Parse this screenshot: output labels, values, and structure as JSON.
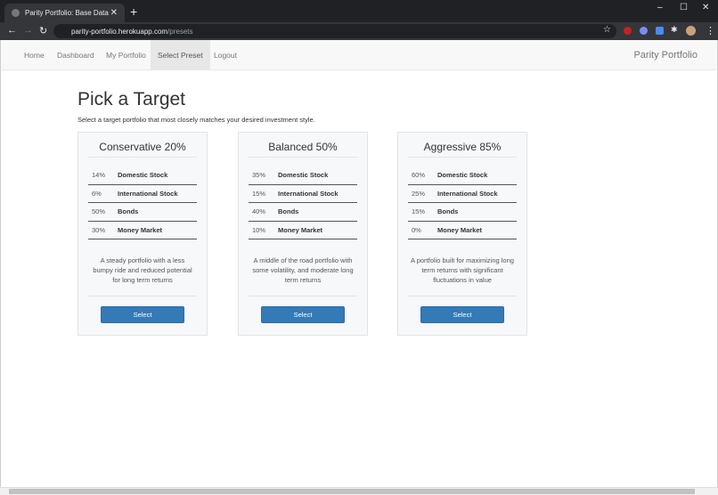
{
  "browser": {
    "tab_title": "Parity Portfolio: Base Data",
    "url_host": "parity-portfolio.herokuapp.com",
    "url_path": "/presets"
  },
  "nav": {
    "items": [
      "Home",
      "Dashboard",
      "My Portfolio",
      "Select Preset",
      "Logout"
    ],
    "active": "Select Preset",
    "brand": "Parity Portfolio"
  },
  "page": {
    "title": "Pick a Target",
    "subtitle": "Select a target portfolio that most closely matches your desired investment style."
  },
  "cards": [
    {
      "title": "Conservative 20%",
      "rows": [
        {
          "pct": "14%",
          "name": "Domestic Stock"
        },
        {
          "pct": "6%",
          "name": "International Stock"
        },
        {
          "pct": "50%",
          "name": "Bonds"
        },
        {
          "pct": "30%",
          "name": "Money Market"
        }
      ],
      "description": "A steady portfolio with a less bumpy ride and reduced potential for long term returns",
      "button": "Select"
    },
    {
      "title": "Balanced 50%",
      "rows": [
        {
          "pct": "35%",
          "name": "Domestic Stock"
        },
        {
          "pct": "15%",
          "name": "International Stock"
        },
        {
          "pct": "40%",
          "name": "Bonds"
        },
        {
          "pct": "10%",
          "name": "Money Market"
        }
      ],
      "description": "A middle of the road portfolio with some volatility, and moderate long term returns",
      "button": "Select"
    },
    {
      "title": "Aggressive 85%",
      "rows": [
        {
          "pct": "60%",
          "name": "Domestic Stock"
        },
        {
          "pct": "25%",
          "name": "International Stock"
        },
        {
          "pct": "15%",
          "name": "Bonds"
        },
        {
          "pct": "0%",
          "name": "Money Market"
        }
      ],
      "description": "A portfolio built for maximizing long term returns with significant fluctuations in value",
      "button": "Select"
    }
  ],
  "colors": {
    "primary": "#337ab7",
    "navbar": "#f8f8f8"
  }
}
